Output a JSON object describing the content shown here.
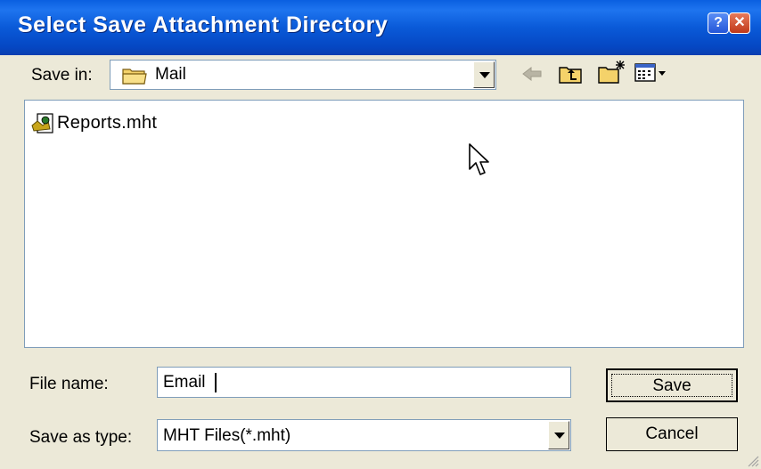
{
  "window": {
    "title": "Select Save Attachment Directory",
    "help_glyph": "?",
    "close_glyph": "✕"
  },
  "save_in": {
    "label": "Save in:",
    "selected": "Mail",
    "icon": "folder-icon"
  },
  "toolbar": {
    "icons": [
      "back-arrow-icon",
      "up-one-level-icon",
      "new-folder-icon",
      "view-menu-icon"
    ]
  },
  "file_list": {
    "items": [
      {
        "name": "Reports.mht",
        "icon": "mht-file-icon"
      }
    ]
  },
  "file_name": {
    "label": "File name:",
    "value": "Email"
  },
  "save_as_type": {
    "label": "Save as type:",
    "selected": "MHT Files(*.mht)"
  },
  "buttons": {
    "save": "Save",
    "cancel": "Cancel"
  },
  "colors": {
    "titlebar": "#0a5ad8",
    "dialog_bg": "#ece9d8",
    "folder": "#f4d26a"
  }
}
